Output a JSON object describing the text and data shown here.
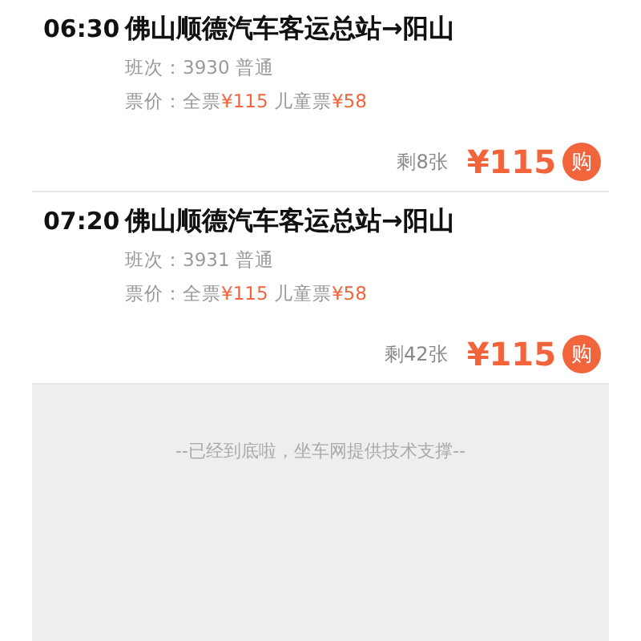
{
  "trips": [
    {
      "time": "06:30",
      "route": "佛山顺德汽车客运总站→阳山",
      "trip_no": "班次：3930 普通",
      "fare": {
        "label": "票价：全票",
        "adult_price": "¥115",
        "child_label": "儿童票",
        "child_price": "¥58"
      },
      "remaining": "剩8张",
      "price": "¥115",
      "buy": "购"
    },
    {
      "time": "07:20",
      "route": "佛山顺德汽车客运总站→阳山",
      "trip_no": "班次：3931 普通",
      "fare": {
        "label": "票价：全票",
        "adult_price": "¥115",
        "child_label": "儿童票",
        "child_price": "¥58"
      },
      "remaining": "剩42张",
      "price": "¥115",
      "buy": "购"
    }
  ],
  "footer": "--已经到底啦，坐车网提供技术支撑--"
}
